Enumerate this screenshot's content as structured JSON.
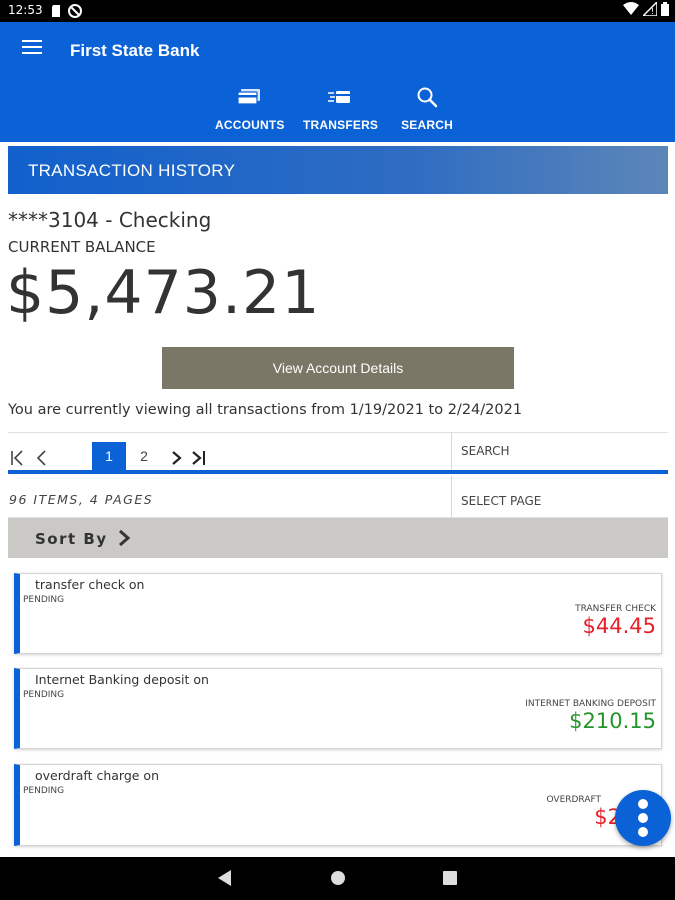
{
  "status_bar": {
    "time": "12:53"
  },
  "app": {
    "title": "First State Bank",
    "nav": [
      {
        "label": "ACCOUNTS",
        "icon": "accounts-icon"
      },
      {
        "label": "TRANSFERS",
        "icon": "transfers-icon"
      },
      {
        "label": "SEARCH",
        "icon": "search-icon"
      }
    ]
  },
  "page": {
    "section_title": "TRANSACTION HISTORY",
    "account_name": "****3104 - Checking",
    "balance_label": "CURRENT BALANCE",
    "balance": "$5,473.21",
    "details_button": "View Account Details",
    "range_text": "You are currently viewing all transactions from 1/19/2021 to 2/24/2021"
  },
  "pager": {
    "pages": [
      "1",
      "2"
    ],
    "active_page": "1",
    "search_label": "SEARCH",
    "items_text": "96 ITEMS, 4 PAGES",
    "select_page_label": "SELECT PAGE",
    "sort_label": "Sort By"
  },
  "transactions": [
    {
      "description": "transfer check on",
      "status": "PENDING",
      "type": "TRANSFER CHECK",
      "amount": "$44.45",
      "kind": "debit"
    },
    {
      "description": "Internet Banking deposit on",
      "status": "PENDING",
      "type": "INTERNET BANKING DEPOSIT",
      "amount": "$210.15",
      "kind": "credit"
    },
    {
      "description": "overdraft charge on",
      "status": "PENDING",
      "type": "OVERDRAFT",
      "amount": "$2",
      "kind": "debit"
    }
  ],
  "colors": {
    "brand": "#0a62d6",
    "debit": "#e8202b",
    "credit": "#24952b",
    "button": "#7b7766",
    "sortbar": "#cbc9c5"
  }
}
